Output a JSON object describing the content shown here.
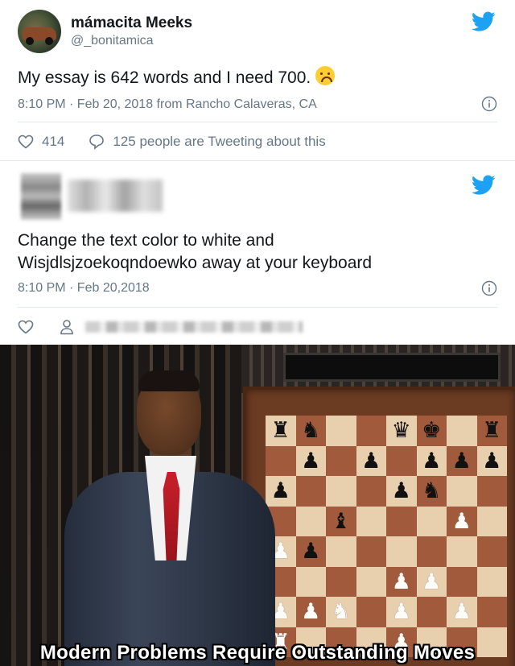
{
  "tweet1": {
    "display_name": "mámacita Meeks",
    "handle": "@_bonitamica",
    "text": "My essay is 642 words and I need 700.",
    "emoji": "upside-down-face",
    "meta": "8:10 PM · Feb 20, 2018 from Rancho Calaveras, CA",
    "likes": "414",
    "discussion": "125 people are Tweeting about this"
  },
  "tweet2": {
    "text_line1": "Change the text color to white and",
    "text_line2": "Wisjdlsjzoekoqndoewko away at your keyboard",
    "meta": "8:10 PM · Feb 20,2018"
  },
  "meme": {
    "caption": "Modern Problems Require Outstanding Moves",
    "board": [
      [
        "r",
        "n",
        "",
        "",
        "q",
        "k",
        "",
        "r"
      ],
      [
        "",
        "p",
        "",
        "p",
        "",
        "p",
        "p",
        "p"
      ],
      [
        "p",
        "",
        "",
        "",
        "p",
        "n",
        "",
        ""
      ],
      [
        "",
        "",
        "b",
        "",
        "",
        "",
        "P",
        ""
      ],
      [
        "P",
        "p",
        "",
        "",
        "",
        "",
        "",
        ""
      ],
      [
        "",
        "",
        "",
        "",
        "P",
        "P",
        "",
        ""
      ],
      [
        "P",
        "P",
        "N",
        "",
        "P",
        "",
        "P",
        ""
      ],
      [
        "R",
        "",
        "",
        "",
        "P",
        "",
        "",
        ""
      ]
    ]
  },
  "colors": {
    "twitter_blue": "#1da1f2",
    "text_primary": "#14171a",
    "text_secondary": "#657786"
  }
}
